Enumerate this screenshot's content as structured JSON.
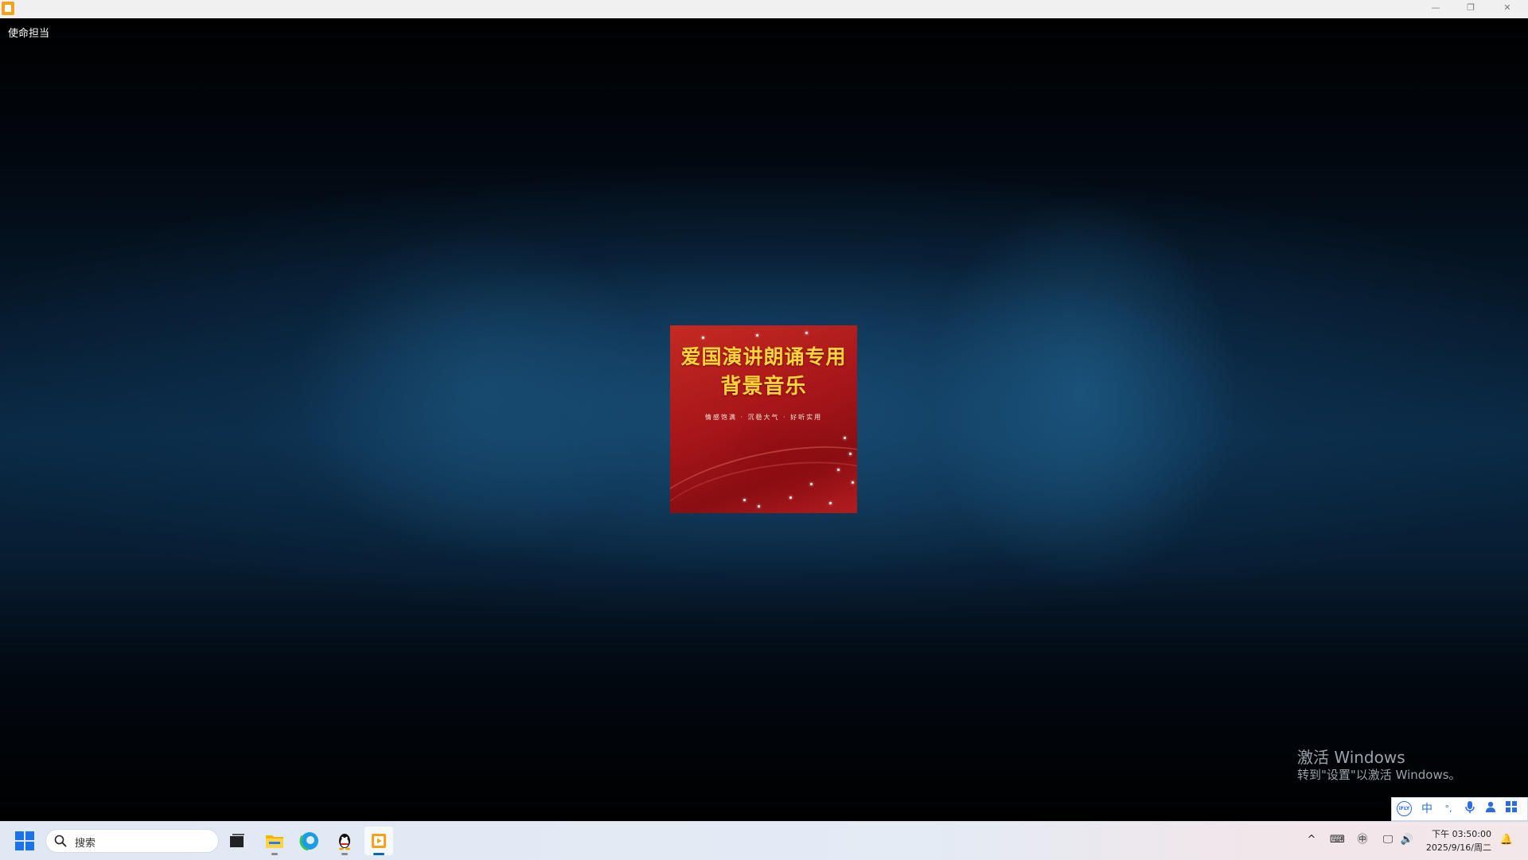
{
  "window": {
    "minimize_glyph": "—",
    "maximize_glyph": "❐",
    "close_glyph": "✕"
  },
  "player": {
    "media_title": "使命担当"
  },
  "album_art": {
    "title_line1": "爱国演讲朗诵专用",
    "title_line2": "背景音乐",
    "subtitle": "情感饱满 · 沉稳大气 · 好听实用"
  },
  "watermark": {
    "title": "激活 Windows",
    "subtitle": "转到\"设置\"以激活 Windows。"
  },
  "ime": {
    "logo": "iFLY",
    "mode": "中",
    "punct": "°,",
    "mic": "🎙",
    "user": "👤",
    "grid": "▦"
  },
  "taskbar": {
    "search_placeholder": "搜索",
    "apps": [
      "task-view",
      "file-explorer",
      "edge",
      "qq",
      "media-player"
    ],
    "accent_color": "#0067c0"
  },
  "tray": {
    "chevron": "^",
    "keyboard": "⌨",
    "ime_lang": "㊥",
    "network": "🖵",
    "volume": "🔊",
    "notification": "🔔",
    "time": "下午 03:50:00",
    "date": "2025/9/16/周二"
  }
}
